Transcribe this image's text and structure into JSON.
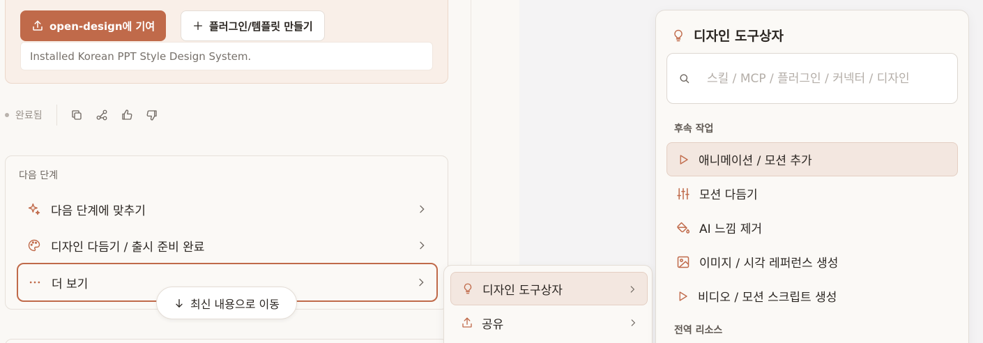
{
  "contribution": {
    "primary_button": "open-design에 기여",
    "secondary_button": "플러그인/템플릿 만들기",
    "installed_text": "Installed Korean PPT Style Design System."
  },
  "status": {
    "label": "완료됨"
  },
  "next_steps": {
    "title": "다음 단계",
    "items": [
      {
        "label": "다음 단계에 맞추기",
        "icon": "sparkle-icon"
      },
      {
        "label": "디자인 다듬기 / 출시 준비 완료",
        "icon": "palette-icon"
      },
      {
        "label": "더 보기",
        "icon": "more-dots-icon"
      }
    ]
  },
  "latest_button": "최신 내용으로 이동",
  "submenu": {
    "items": [
      {
        "label": "디자인 도구상자",
        "icon": "lightbulb-icon"
      },
      {
        "label": "공유",
        "icon": "share-icon"
      }
    ]
  },
  "panel": {
    "title": "디자인 도구상자",
    "search_placeholder": "스킬 / MCP / 플러그인 / 커넥터 / 디자인",
    "section_followup": "후속 작업",
    "items": [
      {
        "label": "애니메이션 / 모션 추가",
        "icon": "play-icon"
      },
      {
        "label": "모션 다듬기",
        "icon": "sliders-icon"
      },
      {
        "label": "AI 느낌 제거",
        "icon": "paint-bucket-icon"
      },
      {
        "label": "이미지 / 시각 레퍼런스 생성",
        "icon": "image-icon"
      },
      {
        "label": "비디오 / 모션 스크립트 생성",
        "icon": "play-icon"
      }
    ],
    "section_global": "전역 리소스"
  },
  "colors": {
    "accent": "#c06a4a",
    "active_bg": "#f3e7e0"
  }
}
